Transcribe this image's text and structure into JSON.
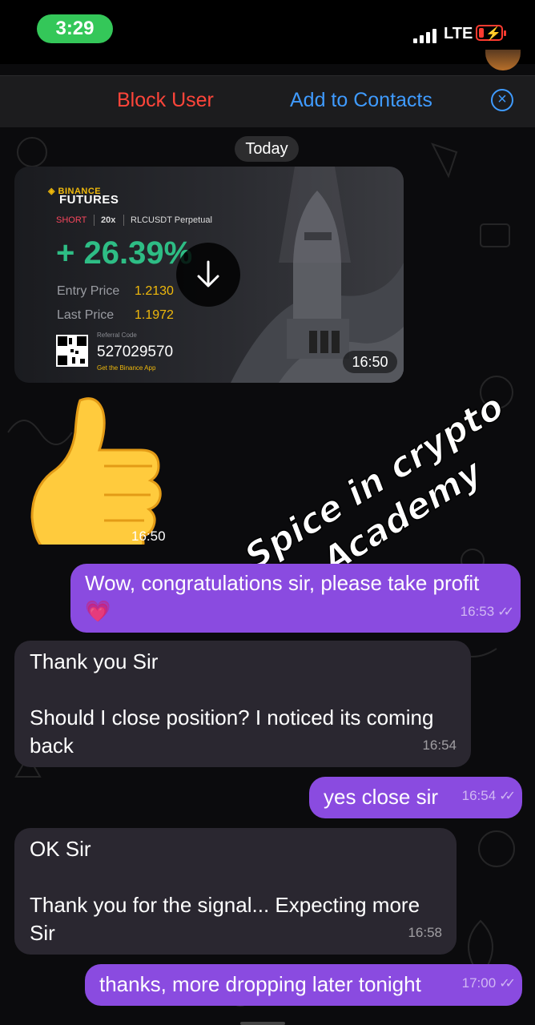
{
  "status_bar": {
    "time": "3:29",
    "network": "LTE"
  },
  "actions": {
    "block_user": "Block User",
    "add_to_contacts": "Add to Contacts",
    "close_icon": "close-circle-icon"
  },
  "date_divider": "Today",
  "image_message": {
    "brand": "BINANCE",
    "product": "FUTURES",
    "side": "SHORT",
    "leverage": "20x",
    "pair": "RLCUSDT Perpetual",
    "pnl": "+ 26.39%",
    "entry_label": "Entry Price",
    "entry_value": "1.2130",
    "last_label": "Last Price",
    "last_value": "1.1972",
    "referral_label": "Referral Code",
    "referral_code": "527029570",
    "referral_app": "Get the Binance App",
    "time": "16:50"
  },
  "sticker": {
    "emoji": "thumbs-up",
    "time": "16:50"
  },
  "watermark": {
    "line1": "Spice in crypto",
    "line2": "Academy"
  },
  "messages": [
    {
      "dir": "out",
      "line1": "Wow, congratulations sir, please take profit",
      "line2": "💗",
      "time": "16:53"
    },
    {
      "dir": "in",
      "line1": "Thank you Sir",
      "line2": "Should I close position? I noticed its coming",
      "line3": "back",
      "time": "16:54"
    },
    {
      "dir": "out",
      "line1": "yes close sir",
      "time": "16:54"
    },
    {
      "dir": "in",
      "line1": "OK Sir",
      "line2": "Thank you for the signal... Expecting more",
      "line3": "Sir",
      "time": "16:58"
    },
    {
      "dir": "out",
      "line1": "thanks, more dropping later tonight",
      "time": "17:00"
    }
  ],
  "colors": {
    "outgoing": "#8a4be0",
    "incoming": "#2a2730",
    "block": "#ff453a",
    "link": "#3f9bff",
    "profit": "#2ebd85"
  }
}
